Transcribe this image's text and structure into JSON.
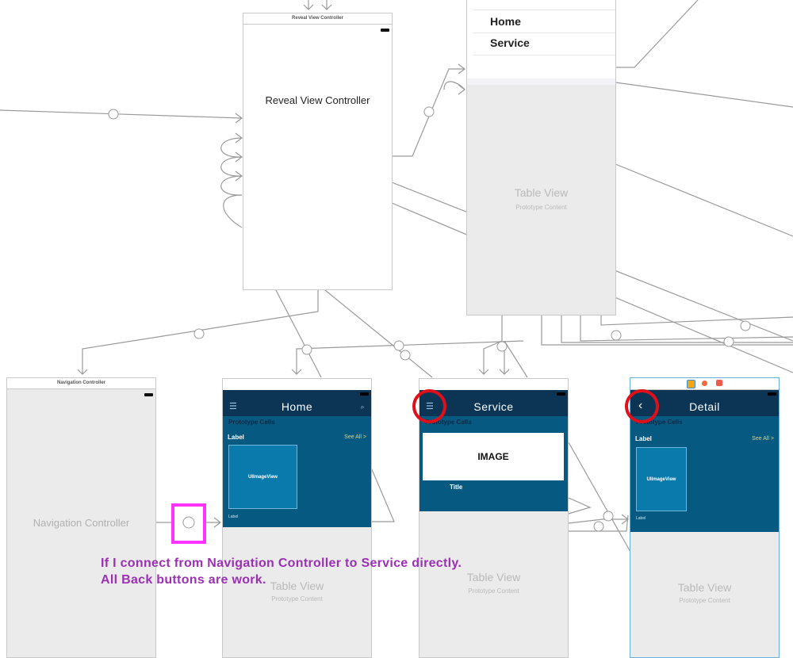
{
  "reveal": {
    "title": "Reveal View Controller",
    "label": "Reveal View Controller"
  },
  "menu": {
    "items": [
      {
        "label": "Home"
      },
      {
        "label": "Service"
      }
    ],
    "table_title": "Table View",
    "table_sub": "Prototype Content"
  },
  "nav": {
    "title": "Navigation Controller",
    "label": "Navigation Controller"
  },
  "home": {
    "nav_title": "Home",
    "prototype_cells": "Prototype Cells",
    "label": "Label",
    "see_all": "See All >",
    "image_view": "UIImageView",
    "small_label": "Label",
    "table_title": "Table View",
    "table_sub": "Prototype Content"
  },
  "service": {
    "nav_title": "Service",
    "prototype_cells": "Prototype Cells",
    "image": "IMAGE",
    "title": "Title",
    "table_title": "Table View",
    "table_sub": "Prototype Content"
  },
  "detail": {
    "nav_title": "Detail",
    "prototype_cells": "Prototype Cells",
    "label": "Label",
    "see_all": "See All >",
    "image_view": "UIImageView",
    "small_label": "Label",
    "table_title": "Table View",
    "table_sub": "Prototype Content"
  },
  "annotation": {
    "line1": "If I connect from Navigation Controller to Service directly.",
    "line2": "All Back buttons are work."
  },
  "colors": {
    "navbar": "#0c3555",
    "content": "#065a82",
    "highlight_circle": "#e0101a",
    "highlight_box": "#ff33ff",
    "annotation": "#9b30b5"
  }
}
